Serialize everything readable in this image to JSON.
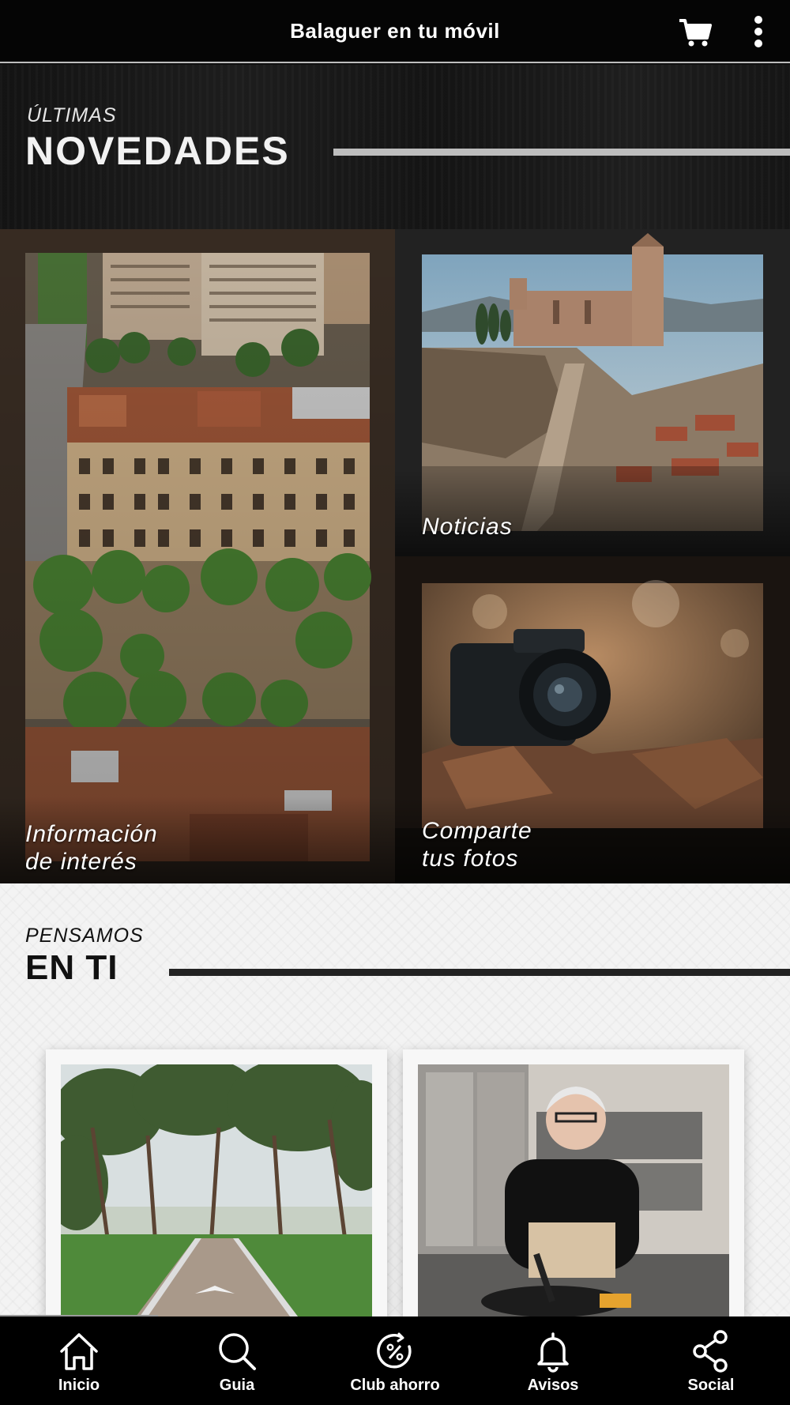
{
  "app": {
    "title": "Balaguer en tu móvil",
    "icons": {
      "cart": "cart-icon",
      "menu": "more-vertical-icon"
    }
  },
  "novedades": {
    "small": "ÚLTIMAS",
    "big": "NOVEDADES"
  },
  "tiles": {
    "info": {
      "line1": "Información",
      "line2": "de interés"
    },
    "noticias": {
      "label": "Noticias"
    },
    "fotos": {
      "line1": "Comparte",
      "line2": "tus fotos"
    }
  },
  "pensamos": {
    "small": "PENSAMOS",
    "big": "EN TI"
  },
  "bottom_nav": [
    {
      "label": "Inicio",
      "icon": "home-icon"
    },
    {
      "label": "Guia",
      "icon": "search-icon"
    },
    {
      "label": "Club ahorro",
      "icon": "discount-icon"
    },
    {
      "label": "Avisos",
      "icon": "bell-icon"
    },
    {
      "label": "Social",
      "icon": "share-icon"
    }
  ],
  "colors": {
    "topbar_bg": "#050505",
    "nav_bg": "#000000",
    "light_section_bg": "#f3f3f3"
  }
}
